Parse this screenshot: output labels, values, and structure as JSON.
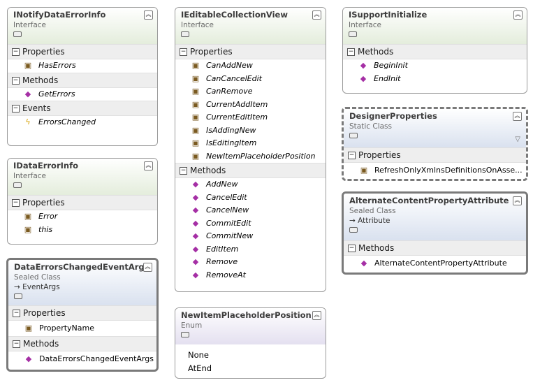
{
  "boxes": {
    "inotify": {
      "title": "INotifyDataErrorInfo",
      "kind": "Interface",
      "sections": [
        {
          "label": "Properties",
          "items": [
            "HasErrors"
          ]
        },
        {
          "label": "Methods",
          "items": [
            "GetErrors"
          ]
        },
        {
          "label": "Events",
          "items": [
            "ErrorsChanged"
          ]
        }
      ]
    },
    "idataerror": {
      "title": "IDataErrorInfo",
      "kind": "Interface",
      "sections": [
        {
          "label": "Properties",
          "items": [
            "Error",
            "this"
          ]
        }
      ]
    },
    "dataerrorsargs": {
      "title": "DataErrorsChangedEventArgs",
      "kind": "Sealed Class",
      "base": "EventArgs",
      "sections": [
        {
          "label": "Properties",
          "items": [
            "PropertyName"
          ]
        },
        {
          "label": "Methods",
          "items": [
            "DataErrorsChangedEventArgs"
          ]
        }
      ]
    },
    "ieditable": {
      "title": "IEditableCollectionView",
      "kind": "Interface",
      "sections": [
        {
          "label": "Properties",
          "items": [
            "CanAddNew",
            "CanCancelEdit",
            "CanRemove",
            "CurrentAddItem",
            "CurrentEditItem",
            "IsAddingNew",
            "IsEditingItem",
            "NewItemPlaceholderPosition"
          ]
        },
        {
          "label": "Methods",
          "items": [
            "AddNew",
            "CancelEdit",
            "CancelNew",
            "CommitEdit",
            "CommitNew",
            "EditItem",
            "Remove",
            "RemoveAt"
          ]
        }
      ]
    },
    "newitempos": {
      "title": "NewItemPlaceholderPosition",
      "kind": "Enum",
      "values": [
        "None",
        "AtEnd"
      ]
    },
    "isupport": {
      "title": "ISupportInitialize",
      "kind": "Interface",
      "sections": [
        {
          "label": "Methods",
          "items": [
            "BeginInit",
            "EndInit"
          ]
        }
      ]
    },
    "designer": {
      "title": "DesignerProperties",
      "kind": "Static Class",
      "sections": [
        {
          "label": "Properties",
          "items": [
            "RefreshOnlyXmlnsDefinitionsOnAsse..."
          ]
        }
      ]
    },
    "alternate": {
      "title": "AlternateContentPropertyAttribute",
      "kind": "Sealed Class",
      "base": "Attribute",
      "sections": [
        {
          "label": "Methods",
          "items": [
            "AlternateContentPropertyAttribute"
          ]
        }
      ]
    }
  },
  "icons": {
    "collapse": "double-chevron-up-icon",
    "section_toggle": "minus-icon",
    "property": "property-icon",
    "method": "method-icon",
    "event": "event-icon",
    "inherit": "arrow-icon",
    "filter": "filter-icon"
  },
  "glyphs": {
    "collapse": "︽",
    "minus": "−",
    "arrow": "→",
    "prop": "▣",
    "meth": "◆",
    "evt": "ϟ",
    "filter": "▽"
  }
}
